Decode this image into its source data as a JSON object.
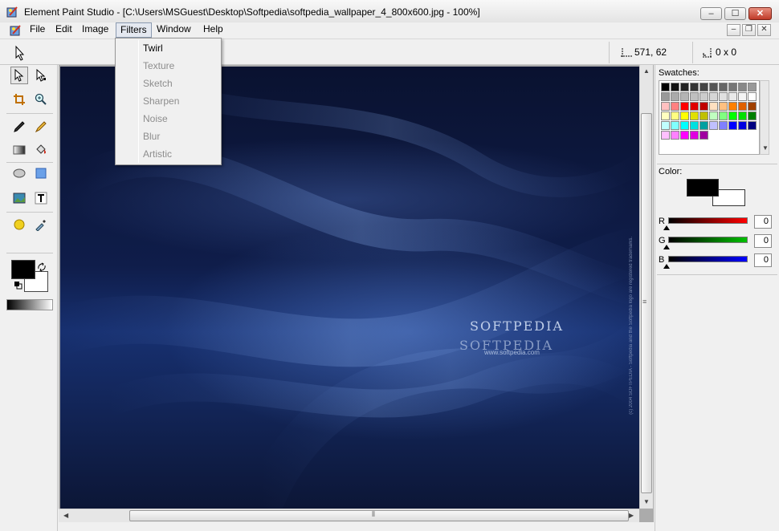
{
  "window": {
    "title": "Element Paint Studio - [C:\\Users\\MSGuest\\Desktop\\Softpedia\\softpedia_wallpaper_4_800x600.jpg - 100%]",
    "minimize": "‒",
    "maximize": "☐",
    "close": "✕"
  },
  "menu": {
    "items": [
      "File",
      "Edit",
      "Image",
      "Filters",
      "Window",
      "Help"
    ],
    "open_item": "Filters",
    "mdi_minimize": "–",
    "mdi_restore": "❐",
    "mdi_close": "✕"
  },
  "optionbar": {
    "cursor_position": "571, 62",
    "selection_size": "0 x 0"
  },
  "filters_menu": [
    {
      "label": "Twirl",
      "enabled": true
    },
    {
      "label": "Texture",
      "enabled": false
    },
    {
      "label": "Sketch",
      "enabled": false
    },
    {
      "label": "Sharpen",
      "enabled": false
    },
    {
      "label": "Noise",
      "enabled": false
    },
    {
      "label": "Blur",
      "enabled": false
    },
    {
      "label": "Artistic",
      "enabled": false
    }
  ],
  "canvas": {
    "logo_text": "SOFTPEDIA",
    "logo_reflection": "SOFTPEDIA",
    "url_text": "www.softpedia.com",
    "copyright_text": "(c) 2004 SOFTPEDIA - Softpedia and the Softpedia logo are registered trademarks."
  },
  "panel": {
    "swatches_label": "Swatches:",
    "color_label": "Color:",
    "foreground": "#000000",
    "background": "#ffffff",
    "channels": [
      {
        "label": "R",
        "value": "0",
        "color": "#ff0000"
      },
      {
        "label": "G",
        "value": "0",
        "color": "#00c000"
      },
      {
        "label": "B",
        "value": "0",
        "color": "#0000ff"
      }
    ],
    "swatch_colors": [
      [
        "#000000",
        "#111111",
        "#222222",
        "#333333",
        "#444444",
        "#555555",
        "#666666",
        "#777777",
        "#888888",
        "#999999"
      ],
      [
        "#999999",
        "#aaaaaa",
        "#b4b4b4",
        "#c0c0c0",
        "#cccccc",
        "#d6d6d6",
        "#e0e0e0",
        "#eaeaea",
        "#f4f4f4",
        "#ffffff"
      ],
      [
        "#ffc0c0",
        "#ff8080",
        "#ff0000",
        "#e00000",
        "#c00000",
        "#ffe0c0",
        "#ffc080",
        "#ff8000",
        "#e06000",
        "#a04000"
      ],
      [
        "#ffffc0",
        "#ffff80",
        "#ffff00",
        "#e0e000",
        "#c0c000",
        "#c0ffc0",
        "#80ff80",
        "#00ff00",
        "#00e000",
        "#008000"
      ],
      [
        "#c0ffff",
        "#80ffff",
        "#00ffff",
        "#00e0e0",
        "#00a0a0",
        "#c0c0ff",
        "#8080ff",
        "#0000ff",
        "#0000e0",
        "#000080"
      ],
      [
        "#ffc0ff",
        "#ff80ff",
        "#ff00ff",
        "#e000e0",
        "#a000a0"
      ]
    ]
  },
  "tools": [
    "pointer-tool",
    "select-tool",
    "crop-tool",
    "zoom-tool",
    "pen-tool",
    "brush-tool",
    "gradient-tool",
    "fill-tool",
    "ellipse-tool",
    "rectangle-tool",
    "image-tool",
    "text-tool",
    "sphere-tool",
    "eyedropper-tool"
  ]
}
